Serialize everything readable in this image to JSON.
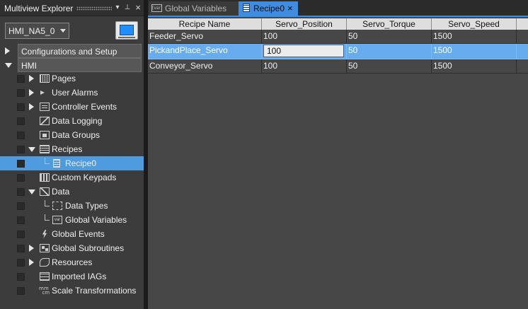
{
  "explorer": {
    "title": "Multiview Explorer",
    "header_buttons": {
      "dropdown": "▾",
      "pin": "⊥",
      "close": "×"
    },
    "device_select": "HMI_NA5_0",
    "device_icon": "hmi-screen-icon",
    "sections": [
      {
        "label": "Configurations and Setup",
        "expanded": false
      },
      {
        "label": "HMI",
        "expanded": true
      }
    ],
    "tree": [
      {
        "label": "Pages",
        "icon": "pages-icon",
        "toggle": "right"
      },
      {
        "label": "User Alarms",
        "icon": "alarm-speaker-icon",
        "toggle": "right"
      },
      {
        "label": "Controller Events",
        "icon": "controller-events-icon",
        "toggle": "right"
      },
      {
        "label": "Data Logging",
        "icon": "data-logging-icon",
        "toggle": ""
      },
      {
        "label": "Data Groups",
        "icon": "data-groups-icon",
        "toggle": ""
      },
      {
        "label": "Recipes",
        "icon": "recipes-icon",
        "toggle": "down"
      },
      {
        "label": "Recipe0",
        "icon": "recipe-icon",
        "toggle": "",
        "selected": true
      },
      {
        "label": "Custom Keypads",
        "icon": "keypad-icon",
        "toggle": ""
      },
      {
        "label": "Data",
        "icon": "data-icon",
        "toggle": "down"
      },
      {
        "label": "Data Types",
        "icon": "data-types-icon",
        "toggle": ""
      },
      {
        "label": "Global Variables",
        "icon": "variable-icon",
        "toggle": ""
      },
      {
        "label": "Global Events",
        "icon": "lightning-icon",
        "toggle": ""
      },
      {
        "label": "Global Subroutines",
        "icon": "subroutines-icon",
        "toggle": "right"
      },
      {
        "label": "Resources",
        "icon": "resources-icon",
        "toggle": "right"
      },
      {
        "label": "Imported IAGs",
        "icon": "iag-icon",
        "toggle": ""
      },
      {
        "label": "Scale Transformations",
        "icon": "scale-icon",
        "toggle": ""
      }
    ]
  },
  "tabs": [
    {
      "label": "Global Variables",
      "icon_text": "[var]",
      "active": false
    },
    {
      "label": "Recipe0",
      "active": true,
      "close": "×"
    }
  ],
  "recipe_grid": {
    "headers": [
      "Recipe Name",
      "Servo_Position",
      "Servo_Torque",
      "Servo_Speed"
    ],
    "rows": [
      [
        "Feeder_Servo",
        "100",
        "50",
        "1500"
      ],
      [
        "PickandPlace_Servo",
        "100",
        "50",
        "1500"
      ],
      [
        "Conveyor_Servo",
        "100",
        "50",
        "1500"
      ]
    ],
    "selected_row": 1,
    "editing_cell": {
      "row": 1,
      "col": 1
    }
  },
  "colors": {
    "selection": "#4e9be0",
    "accent": "#3e8de0",
    "panel": "#3c3c3c"
  }
}
